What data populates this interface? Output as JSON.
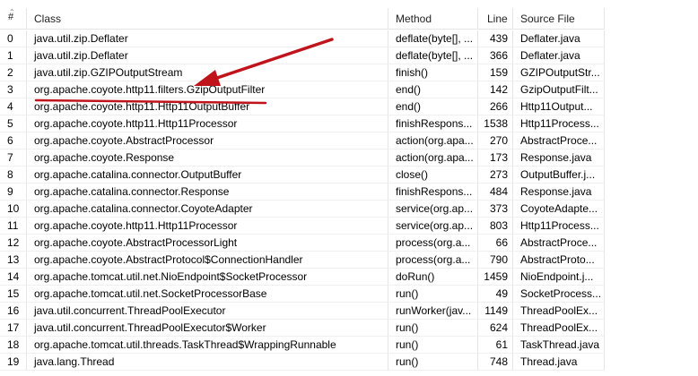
{
  "table": {
    "columns": {
      "index": "#",
      "class": "Class",
      "method": "Method",
      "line": "Line",
      "source": "Source File"
    },
    "rows": [
      {
        "i": "0",
        "cls": "java.util.zip.Deflater",
        "method": "deflate(byte[], ...",
        "line": "439",
        "src": "Deflater.java"
      },
      {
        "i": "1",
        "cls": "java.util.zip.Deflater",
        "method": "deflate(byte[], ...",
        "line": "366",
        "src": "Deflater.java"
      },
      {
        "i": "2",
        "cls": "java.util.zip.GZIPOutputStream",
        "method": "finish()",
        "line": "159",
        "src": "GZIPOutputStr..."
      },
      {
        "i": "3",
        "cls": "org.apache.coyote.http11.filters.GzipOutputFilter",
        "method": "end()",
        "line": "142",
        "src": "GzipOutputFilt..."
      },
      {
        "i": "4",
        "cls": "org.apache.coyote.http11.Http11OutputBuffer",
        "method": "end()",
        "line": "266",
        "src": "Http11Output..."
      },
      {
        "i": "5",
        "cls": "org.apache.coyote.http11.Http11Processor",
        "method": "finishRespons...",
        "line": "1538",
        "src": "Http11Process..."
      },
      {
        "i": "6",
        "cls": "org.apache.coyote.AbstractProcessor",
        "method": "action(org.apa...",
        "line": "270",
        "src": "AbstractProce..."
      },
      {
        "i": "7",
        "cls": "org.apache.coyote.Response",
        "method": "action(org.apa...",
        "line": "173",
        "src": "Response.java"
      },
      {
        "i": "8",
        "cls": "org.apache.catalina.connector.OutputBuffer",
        "method": "close()",
        "line": "273",
        "src": "OutputBuffer.j..."
      },
      {
        "i": "9",
        "cls": "org.apache.catalina.connector.Response",
        "method": "finishRespons...",
        "line": "484",
        "src": "Response.java"
      },
      {
        "i": "10",
        "cls": "org.apache.catalina.connector.CoyoteAdapter",
        "method": "service(org.ap...",
        "line": "373",
        "src": "CoyoteAdapte..."
      },
      {
        "i": "11",
        "cls": "org.apache.coyote.http11.Http11Processor",
        "method": "service(org.ap...",
        "line": "803",
        "src": "Http11Process..."
      },
      {
        "i": "12",
        "cls": "org.apache.coyote.AbstractProcessorLight",
        "method": "process(org.a...",
        "line": "66",
        "src": "AbstractProce..."
      },
      {
        "i": "13",
        "cls": "org.apache.coyote.AbstractProtocol$ConnectionHandler",
        "method": "process(org.a...",
        "line": "790",
        "src": "AbstractProto..."
      },
      {
        "i": "14",
        "cls": "org.apache.tomcat.util.net.NioEndpoint$SocketProcessor",
        "method": "doRun()",
        "line": "1459",
        "src": "NioEndpoint.j..."
      },
      {
        "i": "15",
        "cls": "org.apache.tomcat.util.net.SocketProcessorBase",
        "method": "run()",
        "line": "49",
        "src": "SocketProcess..."
      },
      {
        "i": "16",
        "cls": "java.util.concurrent.ThreadPoolExecutor",
        "method": "runWorker(jav...",
        "line": "1149",
        "src": "ThreadPoolEx..."
      },
      {
        "i": "17",
        "cls": "java.util.concurrent.ThreadPoolExecutor$Worker",
        "method": "run()",
        "line": "624",
        "src": "ThreadPoolEx..."
      },
      {
        "i": "18",
        "cls": "org.apache.tomcat.util.threads.TaskThread$WrappingRunnable",
        "method": "run()",
        "line": "61",
        "src": "TaskThread.java"
      },
      {
        "i": "19",
        "cls": "java.lang.Thread",
        "method": "run()",
        "line": "748",
        "src": "Thread.java"
      }
    ]
  },
  "annotation": {
    "color": "#c0141c",
    "highlighted_row": "3"
  }
}
